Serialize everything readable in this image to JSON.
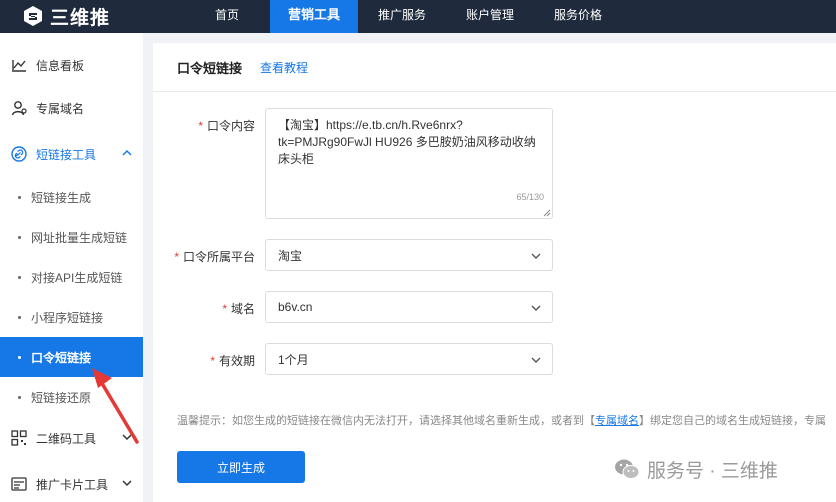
{
  "brand": {
    "name": "三维推"
  },
  "nav": {
    "items": [
      {
        "label": "首页"
      },
      {
        "label": "营销工具"
      },
      {
        "label": "推广服务"
      },
      {
        "label": "账户管理"
      },
      {
        "label": "服务价格"
      }
    ]
  },
  "sidebar": {
    "dashboard": "信息看板",
    "domain": "专属域名",
    "shortlink_group": "短链接工具",
    "sub": [
      "短链接生成",
      "网址批量生成短链",
      "对接API生成短链",
      "小程序短链接",
      "口令短链接",
      "短链接还原"
    ],
    "qrcode_group": "二维码工具",
    "card_group": "推广卡片工具"
  },
  "page": {
    "title": "口令短链接",
    "tutorial": "查看教程"
  },
  "form": {
    "content_label": "口令内容",
    "content_value": "【淘宝】https://e.tb.cn/h.Rve6nrx?tk=PMJRg90FwJl HU926 多巴胺奶油风移动收纳床头柜",
    "content_counter": "65/130",
    "platform_label": "口令所属平台",
    "platform_value": "淘宝",
    "domain_label": "域名",
    "domain_value": "b6v.cn",
    "validity_label": "有效期",
    "validity_value": "1个月",
    "required_mark": "*"
  },
  "tip": {
    "prefix": "温馨提示：如您生成的短链接在微信内无法打开，请选择其他域名重新生成，或者到【",
    "link": "专属域名",
    "suffix": "】绑定您自己的域名生成短链接，专属"
  },
  "generate_button": "立即生成",
  "watermark": "服务号 · 三维推",
  "colors": {
    "primary": "#1677e6",
    "topbar": "#1f2b3d",
    "required": "#e53935"
  }
}
